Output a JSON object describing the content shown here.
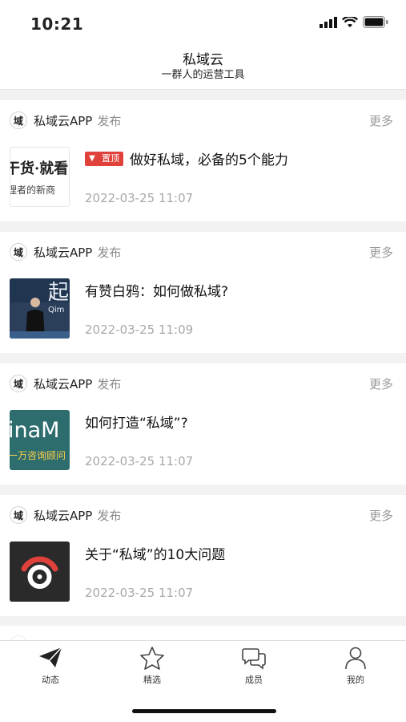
{
  "status_bar": {
    "time": "10:21"
  },
  "header": {
    "title": "私域云",
    "subtitle": "一群人的运营工具"
  },
  "feed": {
    "items": [
      {
        "source_avatar": "域",
        "source": "私域云APP",
        "action": "发布",
        "more": "更多",
        "pinned": true,
        "pin_label": "置顶",
        "title": "做好私域，必备的5个能力",
        "date": "2022-03-25 11:07",
        "thumb_text_a": "干货·就看",
        "thumb_text_b": "理者的新商"
      },
      {
        "source_avatar": "域",
        "source": "私域云APP",
        "action": "发布",
        "more": "更多",
        "pinned": false,
        "title": "有赞白鸦：如何做私域?",
        "date": "2022-03-25 11:09",
        "thumb_text_a": "起",
        "thumb_text_b": "Qim"
      },
      {
        "source_avatar": "域",
        "source": "私域云APP",
        "action": "发布",
        "more": "更多",
        "pinned": false,
        "title": "如何打造“私域”?",
        "date": "2022-03-25 11:07",
        "thumb_text_a": "inaM",
        "thumb_text_b": "一万咨询顾问"
      },
      {
        "source_avatar": "域",
        "source": "私域云APP",
        "action": "发布",
        "more": "更多",
        "pinned": false,
        "title": "关于“私域”的10大问题",
        "date": "2022-03-25 11:07"
      }
    ]
  },
  "tab_bar": {
    "tabs": [
      {
        "label": "动态",
        "icon": "paper-plane-icon",
        "active": true
      },
      {
        "label": "精选",
        "icon": "star-icon",
        "active": false
      },
      {
        "label": "成员",
        "icon": "chat-bubbles-icon",
        "active": false
      },
      {
        "label": "我的",
        "icon": "person-icon",
        "active": false
      }
    ]
  },
  "colors": {
    "accent_red": "#e0413a",
    "date_gray": "#a8a8a8",
    "background": "#f2f2f2"
  }
}
